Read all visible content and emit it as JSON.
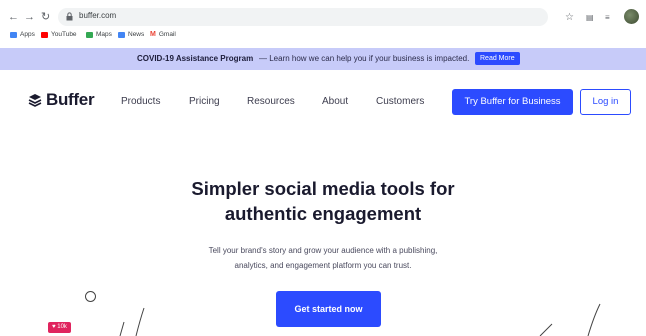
{
  "browser": {
    "url": "buffer.com",
    "bookmarks": [
      {
        "label": "Apps",
        "icon": "apps-grid-icon",
        "color": "#4285f4"
      },
      {
        "label": "YouTube",
        "icon": "youtube-icon",
        "color": "#ff0000"
      },
      {
        "label": "Maps",
        "icon": "maps-icon",
        "color": "#34a853"
      },
      {
        "label": "News",
        "icon": "news-icon",
        "color": "#4285f4"
      },
      {
        "label": "Gmail",
        "icon": "gmail-icon",
        "color": "#ea4335"
      }
    ]
  },
  "banner": {
    "bold": "COVID-19 Assistance Program",
    "text": "— Learn how we can help you if your business is impacted.",
    "button": "Read More"
  },
  "nav": {
    "logo": "Buffer",
    "links": [
      "Products",
      "Pricing",
      "Resources",
      "About",
      "Customers"
    ],
    "try_button": "Try Buffer for Business",
    "login_button": "Log in"
  },
  "hero": {
    "title_line1": "Simpler social media tools for",
    "title_line2": "authentic engagement",
    "sub_line1": "Tell your brand's story and grow your audience with a publishing,",
    "sub_line2": "analytics, and engagement platform you can trust.",
    "cta": "Get started now"
  },
  "decor": {
    "likes_badge": "♥ 10k"
  },
  "colors": {
    "accent": "#2c4bff",
    "banner_bg": "#c7cbf9"
  }
}
